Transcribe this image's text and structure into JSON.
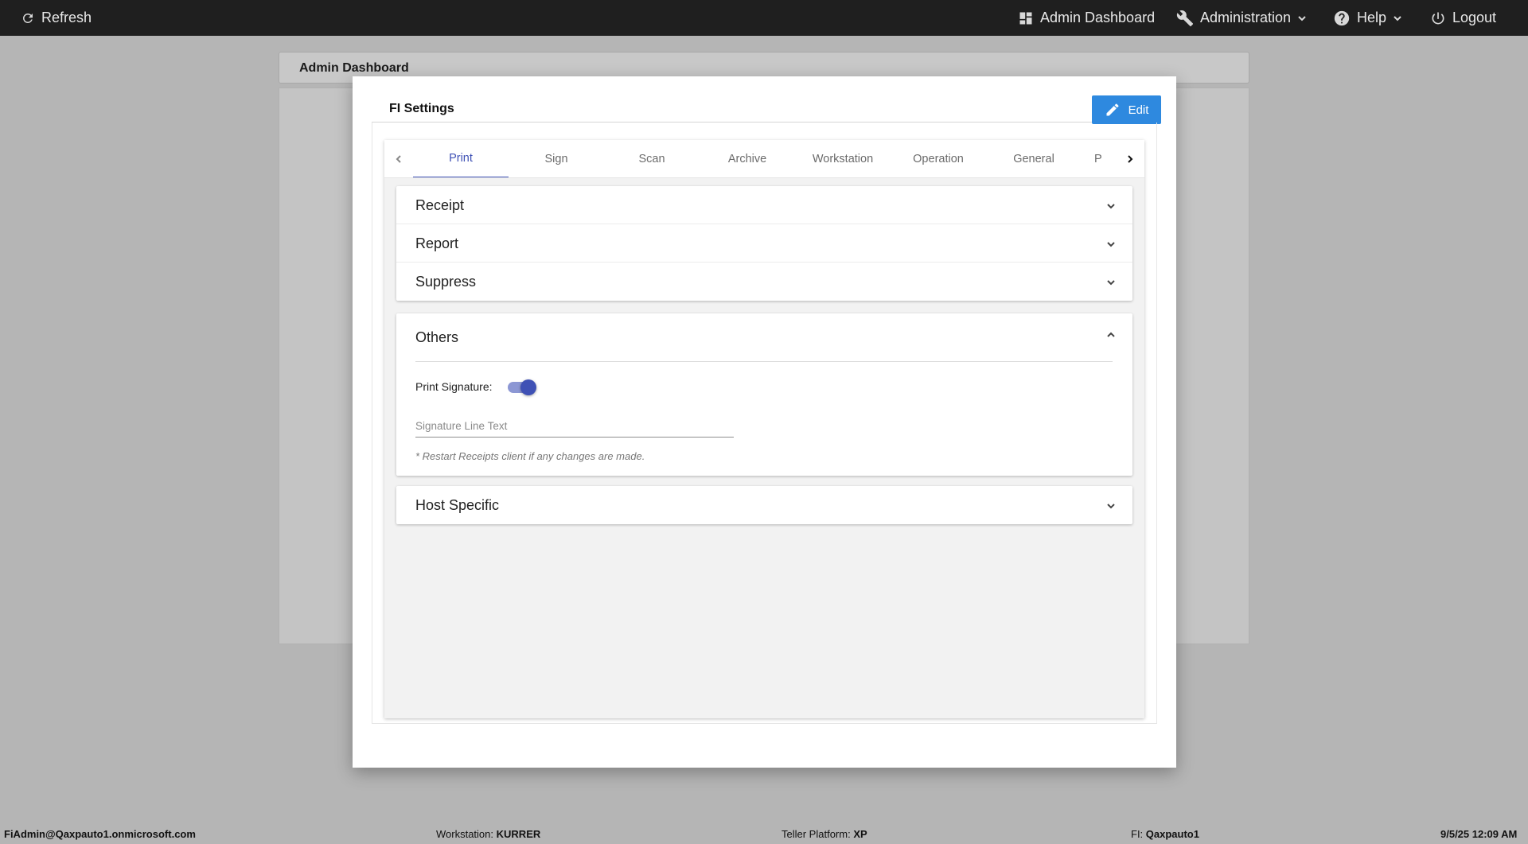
{
  "topbar": {
    "refresh": "Refresh",
    "admin_dashboard": "Admin Dashboard",
    "administration": "Administration",
    "help": "Help",
    "logout": "Logout"
  },
  "background": {
    "card_title": "Admin Dashboard"
  },
  "modal": {
    "title": "FI Settings",
    "edit_label": "Edit"
  },
  "tabs": [
    {
      "label": "Print",
      "active": true
    },
    {
      "label": "Sign"
    },
    {
      "label": "Scan"
    },
    {
      "label": "Archive"
    },
    {
      "label": "Workstation"
    },
    {
      "label": "Operation"
    },
    {
      "label": "General"
    },
    {
      "label": "P"
    }
  ],
  "sections": {
    "receipt": "Receipt",
    "report": "Report",
    "suppress": "Suppress",
    "others": {
      "title": "Others",
      "print_signature_label": "Print Signature:",
      "print_signature_on": true,
      "signature_line_placeholder": "Signature Line Text",
      "signature_line_value": "",
      "note": "* Restart Receipts client if any changes are made."
    },
    "host_specific": "Host Specific"
  },
  "status": {
    "user": "FiAdmin@Qaxpauto1.onmicrosoft.com",
    "workstation_label": "Workstation:",
    "workstation_value": "KURRER",
    "teller_label": "Teller Platform:",
    "teller_value": "XP",
    "fi_label": "FI:",
    "fi_value": "Qaxpauto1",
    "datetime": "9/5/25 12:09 AM"
  },
  "colors": {
    "accent": "#3f51b5",
    "edit_button": "#2e89df",
    "topbar": "#1f1f1f"
  }
}
